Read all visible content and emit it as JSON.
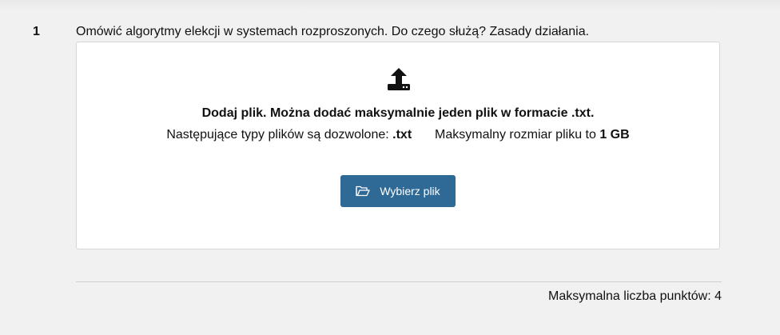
{
  "question": {
    "number": "1",
    "text": "Omówić algorytmy elekcji w systemach rozproszonych. Do czego służą? Zasady działania."
  },
  "upload": {
    "icon": "upload-icon",
    "title": "Dodaj plik. Można dodać maksymalnie jeden plik w formacie .txt.",
    "allowed_types_label": "Następujące typy plików są dozwolone:",
    "allowed_types_value": ".txt",
    "max_size_label": "Maksymalny rozmiar pliku to",
    "max_size_value": "1 GB",
    "button_icon": "folder-open-icon",
    "button_label": "Wybierz plik",
    "button_color": "#2f6a96"
  },
  "footer": {
    "max_points": "Maksymalna liczba punktów: 4"
  }
}
